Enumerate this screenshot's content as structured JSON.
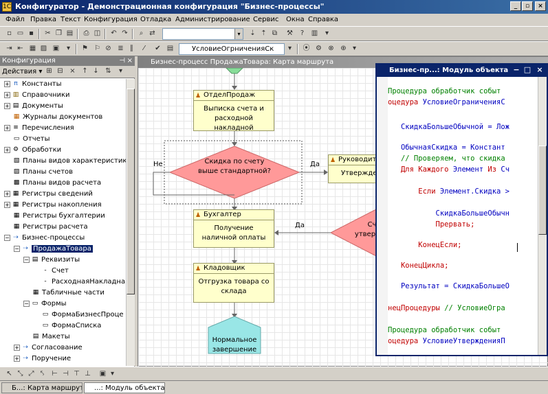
{
  "titlebar": {
    "title": "Конфигуратор - Демонстрационная конфигурация \"Бизнес-процессы\"",
    "min": "_",
    "max": "▫",
    "close": "×"
  },
  "menu": [
    "Файл",
    "Правка",
    "Текст",
    "Конфигурация",
    "Отладка",
    "Администрирование",
    "Сервис",
    "Окна",
    "Справка"
  ],
  "toolbar2": {
    "combo_value": "УсловиеОгрниченияСк"
  },
  "config_panel": {
    "title": "Конфигурация",
    "pin": "⊣",
    "close": "×",
    "actions_label": "Действия ▾",
    "tree": [
      {
        "label": "Константы",
        "exp": "+"
      },
      {
        "label": "Справочники",
        "exp": "+"
      },
      {
        "label": "Документы",
        "exp": "+"
      },
      {
        "label": "Журналы документов",
        "exp": ""
      },
      {
        "label": "Перечисления",
        "exp": "+"
      },
      {
        "label": "Отчеты",
        "exp": ""
      },
      {
        "label": "Обработки",
        "exp": "+"
      },
      {
        "label": "Планы видов характеристик",
        "exp": ""
      },
      {
        "label": "Планы счетов",
        "exp": ""
      },
      {
        "label": "Планы видов расчета",
        "exp": ""
      },
      {
        "label": "Регистры сведений",
        "exp": "+"
      },
      {
        "label": "Регистры накопления",
        "exp": "+"
      },
      {
        "label": "Регистры бухгалтерии",
        "exp": ""
      },
      {
        "label": "Регистры расчета",
        "exp": ""
      },
      {
        "label": "Бизнес-процессы",
        "exp": "−"
      },
      {
        "label": "ПродажаТовара",
        "exp": "−"
      },
      {
        "label": "Реквизиты",
        "exp": "−"
      },
      {
        "label": "Счет",
        "exp": ""
      },
      {
        "label": "РасходнаяНакладна",
        "exp": ""
      },
      {
        "label": "Табличные части",
        "exp": ""
      },
      {
        "label": "Формы",
        "exp": "−"
      },
      {
        "label": "ФормаБизнесПроце",
        "exp": ""
      },
      {
        "label": "ФормаСписка",
        "exp": ""
      },
      {
        "label": "Макеты",
        "exp": ""
      },
      {
        "label": "Согласование",
        "exp": "+"
      },
      {
        "label": "Поручение",
        "exp": "+"
      }
    ]
  },
  "diagram": {
    "title": "Бизнес-процесс ПродажаТовара: Карта маршрута",
    "nodes": {
      "n1": {
        "role": "ОтделПродаж",
        "text": "Выписка счета и расходной накладной"
      },
      "n2": {
        "role": "Руководит",
        "text": "Утвержде"
      },
      "n3": {
        "role": "Бухгалтер",
        "text": "Получение наличной оплаты"
      },
      "n4": {
        "role": "Кладовщик",
        "text": "Отгрузка товара со склада"
      }
    },
    "decision1": "Скидка по счету выше стандартной?",
    "decision2_part1": "Сч",
    "decision2_part2": "утвер",
    "end": "Нормальное завершение",
    "edge_no": "Не",
    "edge_yes1": "Да",
    "edge_yes2": "Да"
  },
  "module": {
    "title": "Бизнес-пр...: Модуль объекта",
    "min": "−",
    "max": "□",
    "close": "×",
    "lines": [
      {
        "fold": "+",
        "parts": [
          {
            "c": "cm",
            "t": "Процедура обработчик событ"
          }
        ]
      },
      {
        "fold": "−",
        "parts": [
          {
            "c": "kw",
            "t": "оцедура "
          },
          {
            "c": "id",
            "t": "УсловиеОграниченияС"
          }
        ]
      },
      {
        "fold": "",
        "parts": []
      },
      {
        "fold": "",
        "parts": [
          {
            "c": "id",
            "t": "   СкидкаБольшеОбычной = Лож"
          }
        ]
      },
      {
        "fold": "",
        "parts": []
      },
      {
        "fold": "",
        "parts": [
          {
            "c": "id",
            "t": "   ОбычнаяСкидка = Констант"
          }
        ]
      },
      {
        "fold": "",
        "parts": [
          {
            "c": "cm",
            "t": "   // Проверяем, что скидка "
          }
        ]
      },
      {
        "fold": "",
        "parts": [
          {
            "c": "kw",
            "t": "   Для Каждого "
          },
          {
            "c": "id",
            "t": "Элемент "
          },
          {
            "c": "kw",
            "t": "Из "
          },
          {
            "c": "id",
            "t": "Сч"
          }
        ]
      },
      {
        "fold": "",
        "parts": []
      },
      {
        "fold": "",
        "parts": [
          {
            "c": "kw",
            "t": "       Если "
          },
          {
            "c": "id",
            "t": "Элемент.Скидка >"
          }
        ]
      },
      {
        "fold": "",
        "parts": []
      },
      {
        "fold": "",
        "parts": [
          {
            "c": "id",
            "t": "           СкидкаБольшеОбычн"
          }
        ]
      },
      {
        "fold": "",
        "parts": [
          {
            "c": "kw",
            "t": "           Прервать;"
          }
        ]
      },
      {
        "fold": "",
        "parts": []
      },
      {
        "fold": "",
        "parts": [
          {
            "c": "kw",
            "t": "       КонецЕсли;"
          }
        ]
      },
      {
        "fold": "",
        "parts": []
      },
      {
        "fold": "",
        "parts": [
          {
            "c": "kw",
            "t": "   КонецЦикла;"
          }
        ]
      },
      {
        "fold": "",
        "parts": []
      },
      {
        "fold": "",
        "parts": [
          {
            "c": "id",
            "t": "   Результат = СкидкаБольшеО"
          }
        ]
      },
      {
        "fold": "",
        "parts": []
      },
      {
        "fold": "",
        "parts": [
          {
            "c": "kw",
            "t": "нецПроцедуры "
          },
          {
            "c": "cm",
            "t": "// УсловиеОгра"
          }
        ]
      },
      {
        "fold": "",
        "parts": []
      },
      {
        "fold": "+",
        "parts": [
          {
            "c": "cm",
            "t": "Процедура обработчик событ"
          }
        ]
      },
      {
        "fold": "−",
        "parts": [
          {
            "c": "kw",
            "t": "оцедура "
          },
          {
            "c": "id",
            "t": "УсловиеУтвержденияП"
          }
        ]
      }
    ]
  },
  "taskbar": {
    "tab1": "Б...: Карта маршрута",
    "tab2": "...: Модуль объекта"
  },
  "colors": {
    "node_fill": "#ffffcc",
    "decision_fill": "#ff9999",
    "end_fill": "#99e6e6",
    "selection": "#0a246a"
  }
}
